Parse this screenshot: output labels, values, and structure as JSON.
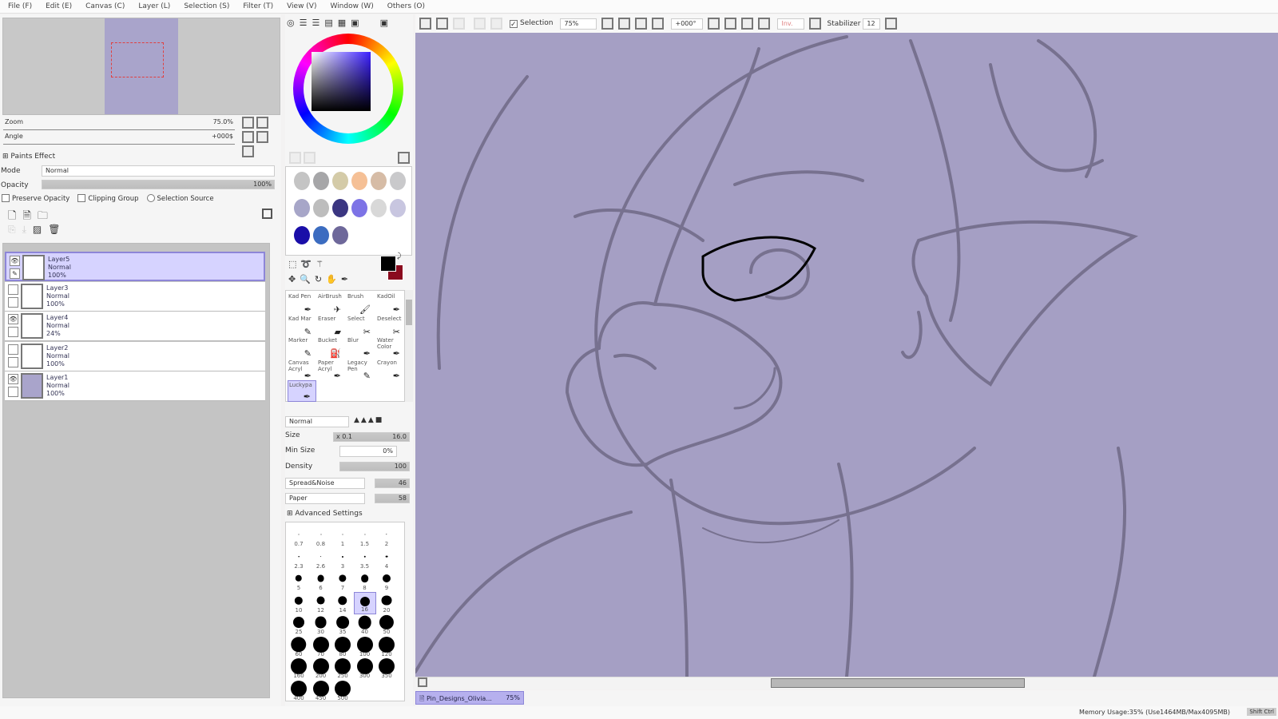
{
  "menu": [
    "File (F)",
    "Edit (E)",
    "Canvas (C)",
    "Layer (L)",
    "Selection (S)",
    "Filter (T)",
    "View (V)",
    "Window (W)",
    "Others (O)"
  ],
  "navigator": {
    "zoom_label": "Zoom",
    "zoom_value": "75.0%",
    "angle_label": "Angle",
    "angle_value": "+000$"
  },
  "layer_props": {
    "paints_effect": "Paints Effect",
    "mode_label": "Mode",
    "mode_value": "Normal",
    "opacity_label": "Opacity",
    "opacity_value": "100%",
    "preserve_opacity": "Preserve Opacity",
    "clipping_group": "Clipping Group",
    "selection_source": "Selection Source"
  },
  "layers": [
    {
      "name": "Layer5",
      "mode": "Normal",
      "opacity": "100%",
      "visible": true,
      "selected": true,
      "thumb": "#ffffff"
    },
    {
      "name": "Layer3",
      "mode": "Normal",
      "opacity": "100%",
      "visible": false,
      "selected": false,
      "thumb": "#ffffff"
    },
    {
      "name": "Layer4",
      "mode": "Normal",
      "opacity": "24%",
      "visible": true,
      "selected": false,
      "thumb": "#ffffff"
    },
    {
      "name": "Layer2",
      "mode": "Normal",
      "opacity": "100%",
      "visible": false,
      "selected": false,
      "thumb": "#ffffff"
    },
    {
      "name": "Layer1",
      "mode": "Normal",
      "opacity": "100%",
      "visible": true,
      "selected": false,
      "thumb": "#a9a4cb"
    }
  ],
  "swatches": [
    "#c4c4c4",
    "#a6a6a8",
    "#d4cba8",
    "#f5c096",
    "#d6bca6",
    "#c9c9cb",
    "#a7a6c8",
    "#bdbdbd",
    "#3b3681",
    "#7d73e6",
    "#d8d8d8",
    "#c8c6e0",
    "#1a0ea8",
    "#3c6cc0",
    "#6e689a"
  ],
  "colors": {
    "primary": "#000000",
    "secondary": "#8a0a1e",
    "canvas_bg": "#a59fc4",
    "accent": "#8d86d8"
  },
  "tools": [
    {
      "label": "Kad Pen",
      "icon": "pen-icon",
      "glyph": "✒"
    },
    {
      "label": "AirBrush",
      "icon": "airbrush-icon",
      "glyph": "✈"
    },
    {
      "label": "Brush",
      "icon": "brush-icon",
      "glyph": "🖌"
    },
    {
      "label": "KadOil",
      "icon": "brush-icon",
      "glyph": "✒"
    },
    {
      "label": "Kad Mar",
      "icon": "marker-icon",
      "glyph": "✎"
    },
    {
      "label": "Eraser",
      "icon": "eraser-icon",
      "glyph": "▰"
    },
    {
      "label": "Select",
      "icon": "select-icon",
      "glyph": "✂"
    },
    {
      "label": "Deselect",
      "icon": "deselect-icon",
      "glyph": "✂"
    },
    {
      "label": "Marker",
      "icon": "marker-icon",
      "glyph": "✎"
    },
    {
      "label": "Bucket",
      "icon": "bucket-icon",
      "glyph": "⛽"
    },
    {
      "label": "Blur",
      "icon": "blur-icon",
      "glyph": "✒"
    },
    {
      "label": "Water Color",
      "icon": "watercolor-icon",
      "glyph": "✒"
    },
    {
      "label": "Canvas Acryl",
      "icon": "acrylic-icon",
      "glyph": "✒"
    },
    {
      "label": "Paper Acryl",
      "icon": "acrylic-icon",
      "glyph": "✒"
    },
    {
      "label": "Legacy Pen",
      "icon": "pen-icon",
      "glyph": "✎"
    },
    {
      "label": "Crayon",
      "icon": "crayon-icon",
      "glyph": "✒"
    },
    {
      "label": "Luckypa",
      "icon": "pen-icon",
      "glyph": "✒",
      "selected": true
    }
  ],
  "brush": {
    "blend_mode": "Normal",
    "size_label": "Size",
    "size_mult": "x 0.1",
    "size_value": "16.0",
    "min_size_label": "Min Size",
    "min_size_value": "0%",
    "density_label": "Density",
    "density_value": "100",
    "texture1": "Spread&Noise",
    "texture1_value": "46",
    "texture2": "Paper",
    "texture2_value": "58",
    "advanced": "Advanced Settings"
  },
  "brush_sizes": [
    "0.7",
    "0.8",
    "1",
    "1.5",
    "2",
    "2.3",
    "2.6",
    "3",
    "3.5",
    "4",
    "5",
    "6",
    "7",
    "8",
    "9",
    "10",
    "12",
    "14",
    "16",
    "20",
    "25",
    "30",
    "35",
    "40",
    "50",
    "60",
    "70",
    "80",
    "100",
    "120",
    "160",
    "200",
    "250",
    "300",
    "350",
    "400",
    "450",
    "500"
  ],
  "brush_selected": "16",
  "toolbar": {
    "selection_label": "Selection",
    "zoom": "75%",
    "angle": "+000°",
    "invert": "Inv.",
    "stabilizer_label": "Stabilizer",
    "stabilizer_value": "12"
  },
  "tab": {
    "name": "Pin_Designs_Olivia...",
    "zoom": "75%"
  },
  "status": {
    "memory": "Memory Usage:35% (Use1464MB/Max4095MB)",
    "keys": "Shift Ctrl"
  }
}
